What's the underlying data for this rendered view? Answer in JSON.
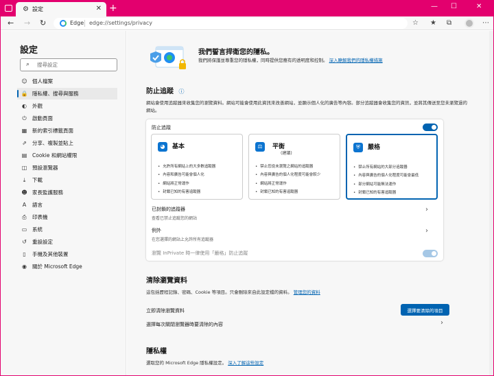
{
  "tab": {
    "title": "設定"
  },
  "address": {
    "site_label": "Edge",
    "url": "edge://settings/privacy"
  },
  "sidebar": {
    "title": "設定",
    "search_placeholder": "搜尋設定",
    "items": [
      {
        "label": "個人檔案",
        "icon": "person-icon"
      },
      {
        "label": "隱私權、搜尋與服務",
        "icon": "lock-icon"
      },
      {
        "label": "外觀",
        "icon": "palette-icon"
      },
      {
        "label": "啟動頁面",
        "icon": "power-icon"
      },
      {
        "label": "新的索引標籤頁面",
        "icon": "new-tab-icon"
      },
      {
        "label": "分享、複製並貼上",
        "icon": "share-icon"
      },
      {
        "label": "Cookie 和網站權限",
        "icon": "site-permissions-icon"
      },
      {
        "label": "預設瀏覽器",
        "icon": "browser-icon"
      },
      {
        "label": "下載",
        "icon": "download-icon"
      },
      {
        "label": "家長監護服務",
        "icon": "family-icon"
      },
      {
        "label": "語言",
        "icon": "language-icon"
      },
      {
        "label": "印表機",
        "icon": "printer-icon"
      },
      {
        "label": "系統",
        "icon": "system-icon"
      },
      {
        "label": "重設設定",
        "icon": "reset-icon"
      },
      {
        "label": "手機及其他裝置",
        "icon": "phone-icon"
      },
      {
        "label": "關於 Microsoft Edge",
        "icon": "edge-icon"
      }
    ]
  },
  "hero": {
    "title": "我們誓言捍衛您的隱私。",
    "desc": "我們將保護並尊重您的隱私權，同時提供您應有的透明度和控制。",
    "link": "深入瞭解我們的隱私權措施"
  },
  "tracking": {
    "title": "防止追蹤",
    "desc": "網站會使用追蹤器來收集您的瀏覽資料。網站可能會使用此資訊來改善網站，並顯示個人化的廣告等內容。部分追蹤器會收集您的資訊，並將其傳送至您未瀏覽過的網站。",
    "toggle_label": "防止追蹤",
    "options": [
      {
        "title": "基本",
        "subtitle": "",
        "bullets": [
          "允許所有網站上的大多數追蹤器",
          "內容和廣告可能會個人化",
          "網站將正常運作",
          "封鎖已知的有害追蹤器"
        ]
      },
      {
        "title": "平衡",
        "subtitle": "(建議)",
        "bullets": [
          "禁止您從未瀏覽之網站的追蹤器",
          "內容與廣告的個人化程度可能會較少",
          "網站將正常運作",
          "封鎖已知的有害追蹤器"
        ]
      },
      {
        "title": "嚴格",
        "subtitle": "",
        "bullets": [
          "禁止所有網站的大部分追蹤器",
          "內容與廣告的個人化程度可能會最低",
          "部分網站可能無法運作",
          "封鎖已知的有害追蹤器"
        ]
      }
    ],
    "blocked_title": "已封鎖的追蹤器",
    "blocked_sub": "查看已禁止追蹤您的網站",
    "exceptions_title": "例外",
    "exceptions_sub": "在您選擇的網站上允許所有追蹤器",
    "inprivate_label": "瀏覽 InPrivate 時一律使用「嚴格」防止追蹤"
  },
  "clear": {
    "title": "清除瀏覽資料",
    "desc_prefix": "這包括歷程記錄、密碼、Cookie 等項目。只會刪除來自此設定檔的資料。",
    "desc_link": "管理您的資料",
    "clear_now": "立即清除瀏覽資料",
    "choose_button": "選擇要清除的項目",
    "on_close": "選擇每次關閉瀏覽器時要清除的內容"
  },
  "privacy": {
    "title": "隱私權",
    "desc_prefix": "選取您的 Microsoft Edge 隱私權設定。",
    "desc_link": "深入了解這些設定"
  }
}
